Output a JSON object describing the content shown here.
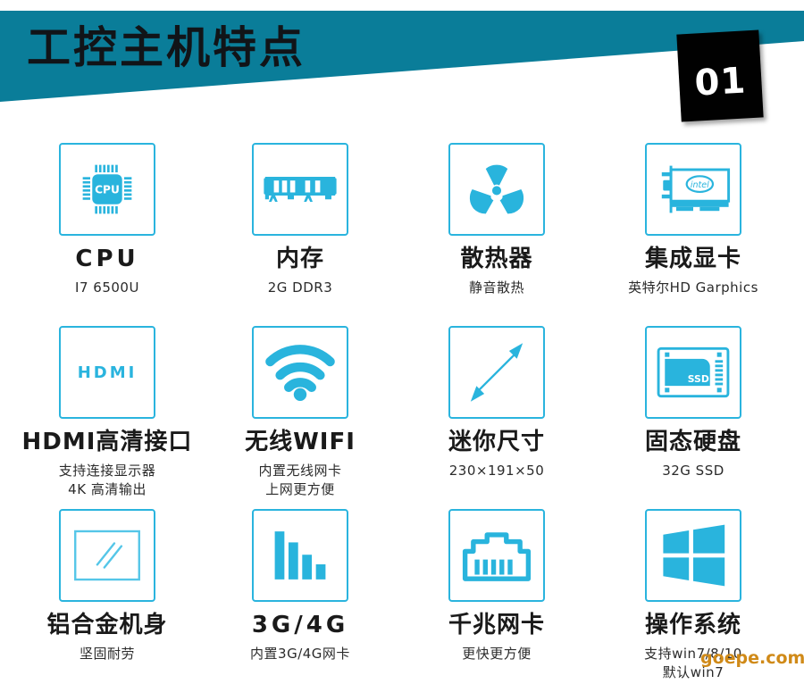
{
  "header": {
    "title": "工控主机特点",
    "badge_number": "01",
    "band_color": "#0a7d99",
    "badge_color": "#010101"
  },
  "theme": {
    "accent": "#2ab4de",
    "icon_fill": "#29b4dd",
    "title_color": "#1a1a1a"
  },
  "watermark": "goepe.com",
  "features": [
    {
      "icon": "cpu-chip-icon",
      "title": "CPU",
      "subtitle": "I7 6500U",
      "subtitle2": ""
    },
    {
      "icon": "memory-ram-icon",
      "title": "内存",
      "subtitle": "2G DDR3",
      "subtitle2": ""
    },
    {
      "icon": "cooling-fan-icon",
      "title": "散热器",
      "subtitle": "静音散热",
      "subtitle2": ""
    },
    {
      "icon": "graphics-card-icon",
      "title": "集成显卡",
      "subtitle": "英特尔HD Garphics",
      "subtitle2": ""
    },
    {
      "icon": "hdmi-port-icon",
      "title": "HDMI高清接口",
      "subtitle": "支持连接显示器",
      "subtitle2": "4K 高清输出"
    },
    {
      "icon": "wifi-icon",
      "title": "无线WIFI",
      "subtitle": "内置无线网卡",
      "subtitle2": "上网更方便"
    },
    {
      "icon": "mini-size-arrow-icon",
      "title": "迷你尺寸",
      "subtitle": "230×191×50",
      "subtitle2": ""
    },
    {
      "icon": "ssd-drive-icon",
      "title": "固态硬盘",
      "subtitle": "32G  SSD",
      "subtitle2": ""
    },
    {
      "icon": "aluminum-body-icon",
      "title": "铝合金机身",
      "subtitle": "坚固耐劳",
      "subtitle2": ""
    },
    {
      "icon": "signal-bars-icon",
      "title": "3G/4G",
      "subtitle": "内置3G/4G网卡",
      "subtitle2": ""
    },
    {
      "icon": "ethernet-port-icon",
      "title": "千兆网卡",
      "subtitle": "更快更方便",
      "subtitle2": ""
    },
    {
      "icon": "windows-logo-icon",
      "title": "操作系统",
      "subtitle": "支持win7/8/10",
      "subtitle2": "默认win7"
    }
  ],
  "icon_labels": {
    "cpu": "CPU",
    "hdmi": "HDMI",
    "ssd": "SSD",
    "intel": "intel"
  }
}
